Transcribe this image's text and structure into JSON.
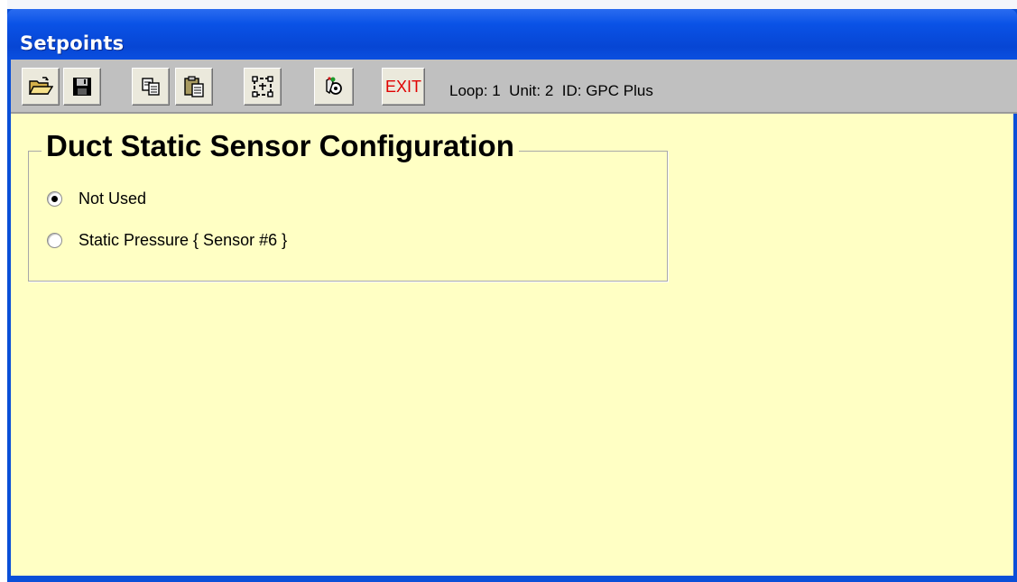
{
  "window": {
    "title": "Setpoints"
  },
  "toolbar": {
    "buttons": [
      {
        "icon": "open-folder-icon"
      },
      {
        "icon": "save-disk-icon"
      },
      {
        "icon": "copy-icon"
      },
      {
        "icon": "paste-icon"
      },
      {
        "icon": "select-frame-icon"
      },
      {
        "icon": "hand-gear-icon"
      },
      {
        "icon": "exit-text",
        "label": "EXIT"
      }
    ],
    "status": "Loop: 1  Unit: 2  ID: GPC Plus"
  },
  "group": {
    "title": "Duct Static Sensor Configuration",
    "options": [
      {
        "label": "Not Used",
        "selected": true
      },
      {
        "label": "Static Pressure { Sensor #6 }",
        "selected": false
      }
    ]
  },
  "colors": {
    "titlebar": "#0a52e6",
    "toolbar": "#c0c0c0",
    "content_background": "#ffffc4",
    "exit_text": "#e00000"
  }
}
